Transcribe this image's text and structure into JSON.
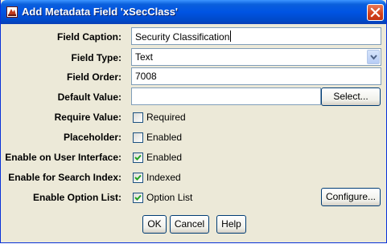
{
  "window": {
    "title": "Add Metadata Field 'xSecClass'"
  },
  "form": {
    "field_caption": {
      "label": "Field Caption:",
      "value": "Security Classification"
    },
    "field_type": {
      "label": "Field Type:",
      "value": "Text"
    },
    "field_order": {
      "label": "Field Order:",
      "value": "7008"
    },
    "default_value": {
      "label": "Default Value:",
      "value": "",
      "button": "Select..."
    },
    "require_value": {
      "label": "Require Value:",
      "checkbox_label": "Required",
      "checked": false
    },
    "placeholder": {
      "label": "Placeholder:",
      "checkbox_label": "Enabled",
      "checked": false
    },
    "enable_ui": {
      "label": "Enable on User Interface:",
      "checkbox_label": "Enabled",
      "checked": true
    },
    "enable_search": {
      "label": "Enable for Search Index:",
      "checkbox_label": "Indexed",
      "checked": true
    },
    "enable_option_list": {
      "label": "Enable Option List:",
      "checkbox_label": "Option List",
      "checked": true,
      "button": "Configure..."
    }
  },
  "buttons": {
    "ok": "OK",
    "cancel": "Cancel",
    "help": "Help"
  },
  "colors": {
    "title_bar": "#0054e3",
    "window_bg": "#ece9d8",
    "close_button": "#d2401b"
  }
}
